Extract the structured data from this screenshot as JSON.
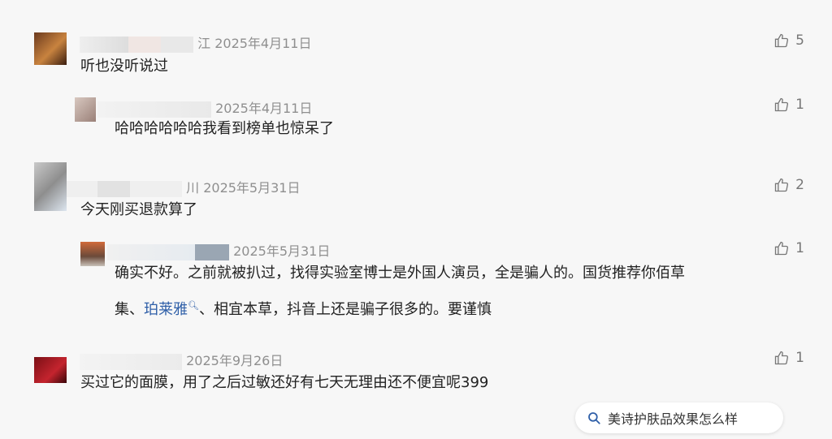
{
  "comments": [
    {
      "name_fragment": "江",
      "date": "2025年4月11日",
      "text": "听也没听说过",
      "likes": "5"
    },
    {
      "name_fragment": "",
      "date": "2025年4月11日",
      "text": "哈哈哈哈哈哈我看到榜单也惊呆了",
      "likes": "1"
    },
    {
      "name_fragment": "川",
      "date": "2025年5月31日",
      "text": "今天刚买退款算了",
      "likes": "2"
    },
    {
      "name_fragment": "",
      "date": "2025年5月31日",
      "text_line1": "确实不好。之前就被扒过，找得实验室博士是外国人演员，全是骗人的。国货推荐你佰草",
      "text_line2_pre": "集、",
      "text_link": "珀莱雅",
      "text_line2_post": "、相宜本草，抖音上还是骗子很多的。要谨慎",
      "likes": "1"
    },
    {
      "name_fragment": "",
      "date": "2025年9月26日",
      "text": "买过它的面膜，用了之后过敏还好有七天无理由还不便宜呢399",
      "likes": "1"
    }
  ],
  "suggestion": {
    "label": "美诗护肤品效果怎么样",
    "icon": "search-icon"
  },
  "colors": {
    "link": "#2f5fa8",
    "meta": "#8f8f8f",
    "background": "#f7f7f7"
  }
}
